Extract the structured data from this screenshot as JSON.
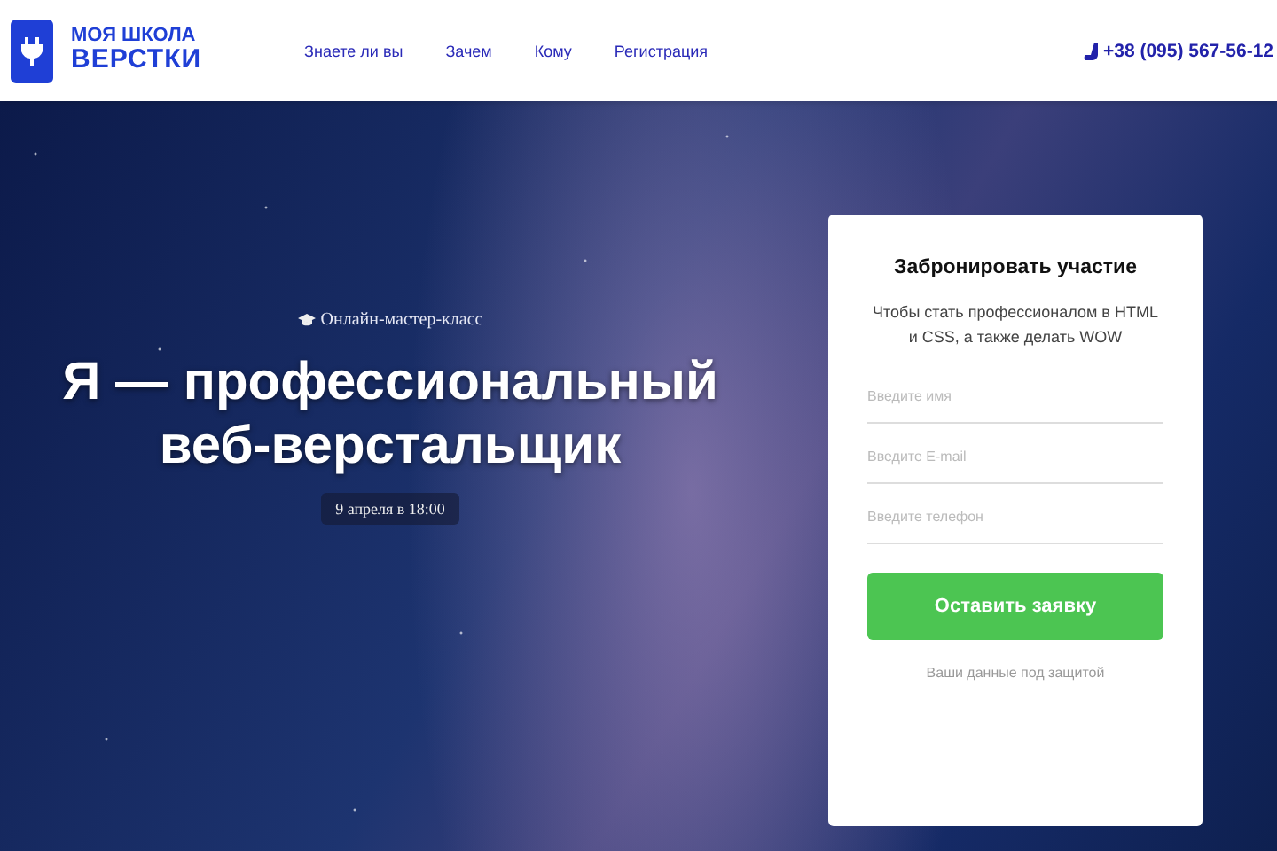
{
  "header": {
    "logo": {
      "line1": "МОЯ ШКОЛА",
      "line2": "ВЕРСТКИ"
    },
    "nav": [
      {
        "label": "Знаете ли вы"
      },
      {
        "label": "Зачем"
      },
      {
        "label": "Кому"
      },
      {
        "label": "Регистрация"
      }
    ],
    "phone": "+38 (095) 567-56-12"
  },
  "hero": {
    "eyebrow": "Онлайн-мастер-класс",
    "title": "Я — профессиональный веб-верстальщик",
    "date": "9 апреля в 18:00"
  },
  "form": {
    "title": "Забронировать участие",
    "subtitle": "Чтобы стать профессионалом в HTML и CSS, а также делать WOW",
    "fields": [
      {
        "placeholder": "Введите имя"
      },
      {
        "placeholder": "Введите E-mail"
      },
      {
        "placeholder": "Введите телефон"
      }
    ],
    "button": "Оставить заявку",
    "note": "Ваши данные под защитой"
  }
}
